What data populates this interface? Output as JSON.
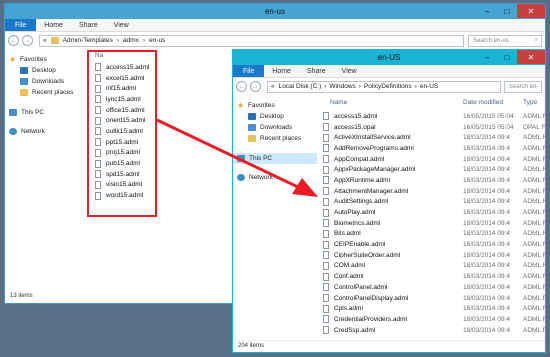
{
  "back_window": {
    "title": "en-us",
    "ribbon": {
      "file": "File",
      "tabs": [
        "Home",
        "Share",
        "View"
      ]
    },
    "address": {
      "segments": [
        "Admin-Templates",
        "admx",
        "en-us"
      ],
      "separator": "›",
      "prefix": "«"
    },
    "search_placeholder": "Search en-us",
    "column_header_partial": "Na",
    "nav": [
      {
        "label": "Favorites",
        "icon": "star-icon"
      },
      {
        "label": "Desktop",
        "icon": "desktop-icon"
      },
      {
        "label": "Downloads",
        "icon": "downloads-icon"
      },
      {
        "label": "Recent places",
        "icon": "recent-places-icon"
      },
      {
        "label": "This PC",
        "icon": "this-pc-icon"
      },
      {
        "label": "Network",
        "icon": "network-icon"
      }
    ],
    "files": [
      "access15.adml",
      "excel15.adml",
      "inf15.adml",
      "lync15.adml",
      "office15.adml",
      "onent15.adml",
      "outlk15.adml",
      "ppt15.adml",
      "proj15.adml",
      "pub15.adml",
      "spd15.adml",
      "visio15.adml",
      "word15.adml"
    ],
    "status": "13 items"
  },
  "front_window": {
    "title": "en-US",
    "ribbon": {
      "file": "File",
      "tabs": [
        "Home",
        "Share",
        "View"
      ]
    },
    "address": {
      "segments": [
        "Local Disk (C:)",
        "Windows",
        "PolicyDefinitions",
        "en-US"
      ],
      "separator": "›",
      "prefix": "«"
    },
    "search_placeholder": "Search en-US",
    "columns": {
      "name": "Name",
      "date": "Date modified",
      "type": "Type"
    },
    "nav": [
      {
        "label": "Favorites",
        "icon": "star-icon"
      },
      {
        "label": "Desktop",
        "icon": "desktop-icon"
      },
      {
        "label": "Downloads",
        "icon": "downloads-icon"
      },
      {
        "label": "Recent places",
        "icon": "recent-places-icon"
      },
      {
        "label": "This PC",
        "icon": "this-pc-icon"
      },
      {
        "label": "Network",
        "icon": "network-icon"
      }
    ],
    "files": [
      {
        "name": "access15.adml",
        "date": "16/05/2015 05:04",
        "type": "ADML File"
      },
      {
        "name": "access15.opal",
        "date": "16/05/2015 05:04",
        "type": "OPAL File"
      },
      {
        "name": "ActiveXInstallService.adml",
        "date": "18/03/2014 09:4",
        "type": "ADML File"
      },
      {
        "name": "AddRemovePrograms.adml",
        "date": "18/03/2014 09:4",
        "type": "ADML File"
      },
      {
        "name": "AppCompat.adml",
        "date": "18/03/2014 09:4",
        "type": "ADML File"
      },
      {
        "name": "AppxPackageManager.adml",
        "date": "18/03/2014 09:4",
        "type": "ADML File"
      },
      {
        "name": "AppXRuntime.adml",
        "date": "18/03/2014 09:4",
        "type": "ADML File"
      },
      {
        "name": "AttachmentManager.adml",
        "date": "18/03/2014 09:4",
        "type": "ADML File"
      },
      {
        "name": "AuditSettings.adml",
        "date": "18/03/2014 09:4",
        "type": "ADML File"
      },
      {
        "name": "AutoPlay.adml",
        "date": "18/03/2014 09:4",
        "type": "ADML File"
      },
      {
        "name": "Biometrics.adml",
        "date": "18/03/2014 09:4",
        "type": "ADML File"
      },
      {
        "name": "Bits.adml",
        "date": "18/03/2014 09:4",
        "type": "ADML File"
      },
      {
        "name": "CEIPEnable.adml",
        "date": "18/03/2014 09:4",
        "type": "ADML File"
      },
      {
        "name": "CipherSuiteOrder.adml",
        "date": "18/03/2014 09:4",
        "type": "ADML File"
      },
      {
        "name": "COM.adml",
        "date": "18/03/2014 09:4",
        "type": "ADML File"
      },
      {
        "name": "Conf.adml",
        "date": "18/03/2014 09:4",
        "type": "ADML File"
      },
      {
        "name": "ControlPanel.adml",
        "date": "18/03/2014 09:4",
        "type": "ADML File"
      },
      {
        "name": "ControlPanelDisplay.adml",
        "date": "18/03/2014 09:4",
        "type": "ADML File"
      },
      {
        "name": "Cpls.adml",
        "date": "18/03/2014 09:4",
        "type": "ADML File"
      },
      {
        "name": "CredentialProviders.adml",
        "date": "18/03/2014 09:4",
        "type": "ADML File"
      },
      {
        "name": "CredSsp.adml",
        "date": "18/03/2014 09:4",
        "type": "ADML File"
      }
    ],
    "status": "204 items"
  },
  "colors": {
    "accent": "#1979ca",
    "highlight": "#ed1c24",
    "frame_back": "#3f9ac9",
    "frame_front": "#1bb3d6"
  }
}
